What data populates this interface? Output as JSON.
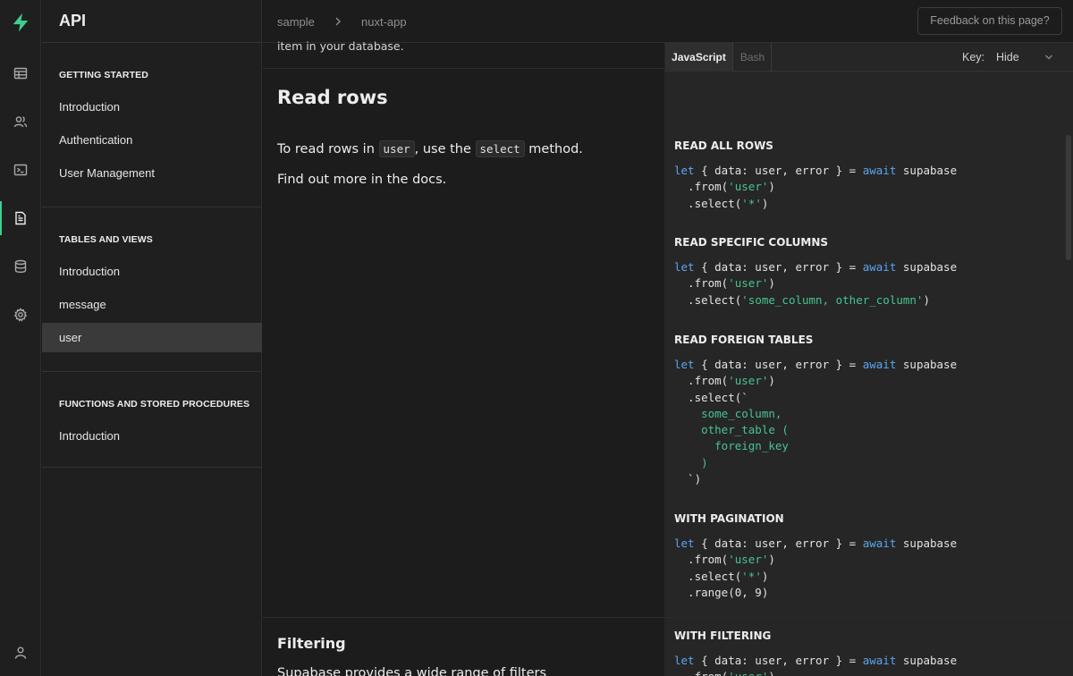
{
  "sidebar": {
    "title": "API",
    "sections": [
      {
        "heading": "GETTING STARTED",
        "items": [
          "Introduction",
          "Authentication",
          "User Management"
        ]
      },
      {
        "heading": "TABLES AND VIEWS",
        "items": [
          "Introduction",
          "message",
          "user"
        ],
        "active": "user"
      },
      {
        "heading": "FUNCTIONS AND STORED PROCEDURES",
        "items": [
          "Introduction"
        ]
      }
    ]
  },
  "rail": {
    "icons": [
      "supabase-logo-icon",
      "table-editor-icon",
      "users-icon",
      "sql-terminal-icon",
      "api-docs-icon",
      "database-icon",
      "settings-icon",
      "profile-icon"
    ],
    "active": "api-docs-icon",
    "accent": "#3ecf8e"
  },
  "header": {
    "breadcrumb": [
      "sample",
      "nuxt-app"
    ],
    "feedback_label": "Feedback on this page?"
  },
  "content": {
    "truncated_text": "item in your database.",
    "read_rows": {
      "title": "Read rows",
      "line1_pre": "To read rows in",
      "line1_code1": "user",
      "line1_mid": ", use the",
      "line1_code2": "select",
      "line1_post": "method.",
      "line2": "Find out more in the docs."
    },
    "filtering": {
      "title": "Filtering",
      "text": "Supabase provides a wide range of filters"
    }
  },
  "code_panel": {
    "tabs": [
      "JavaScript",
      "Bash"
    ],
    "active_tab": "JavaScript",
    "key_label": "Key:",
    "key_value": "Hide",
    "blocks": [
      {
        "title": "READ ALL ROWS"
      },
      {
        "title": "READ SPECIFIC COLUMNS"
      },
      {
        "title": "READ FOREIGN TABLES"
      },
      {
        "title": "WITH PAGINATION"
      },
      {
        "title": "WITH FILTERING"
      }
    ],
    "code": {
      "let": "let",
      "await": "await",
      "decl": " { data: user, error } = ",
      "client": " supabase",
      "from_open": "  .from(",
      "from_arg": "'user'",
      "close": ")",
      "select_open": "  .select(",
      "select_star": "'*'",
      "select_cols": "'some_column, other_column'",
      "select_tick": "  .select(`",
      "fk_line1": "    some_column,",
      "fk_line2": "    other_table (",
      "fk_line3": "      foreign_key",
      "fk_line4": "    )",
      "fk_end": "  `)",
      "range": "  .range(0, 9)"
    }
  }
}
